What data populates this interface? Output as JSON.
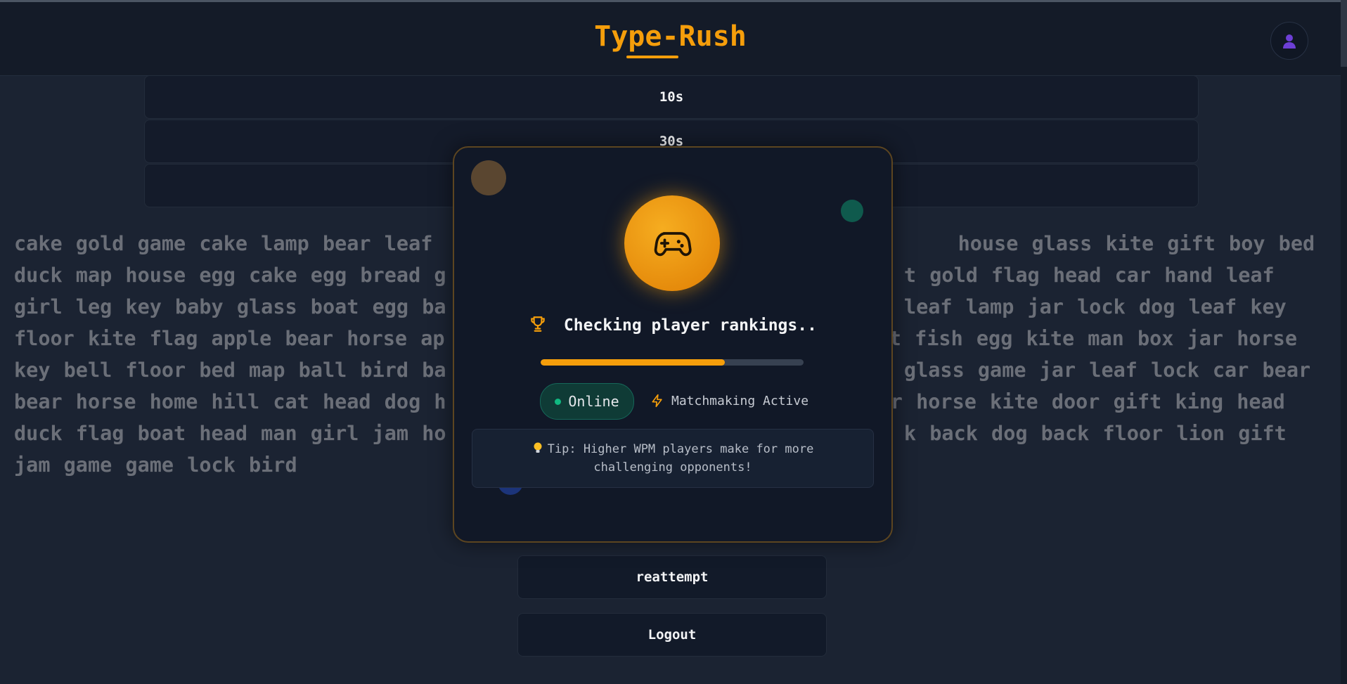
{
  "app": {
    "title": "Type-Rush"
  },
  "header": {
    "avatar_icon": "user-icon"
  },
  "modes": [
    {
      "label": "10s"
    },
    {
      "label": "30s"
    },
    {
      "label": ""
    }
  ],
  "words": {
    "text": "cake gold game cake lamp bear leaf                                       house glass kite gift boy bed duck map house egg cake egg bread g                                  t gold flag head car hand leaf girl leg key baby glass boat egg ba                                  leaf lamp jar lock dog leaf key floor kite flag apple bear horse ap                                 t fish egg kite man box jar horse key bell floor bed map ball bird ba                                  glass game jar leaf lock car bear bear horse home hill cat head dog h                                 r horse kite door gift king head duck flag boat head man girl jam ho                                  k back dog back floor lion gift jam game game lock bird"
  },
  "actions": {
    "reattempt_label": "reattempt",
    "logout_label": "Logout"
  },
  "modal": {
    "icon": "gamepad-icon",
    "status_icon": "trophy-icon",
    "status_text": "Checking player rankings..",
    "progress": 0.7,
    "online_label": "Online",
    "matchmaking_icon": "lightning-icon",
    "matchmaking_label": "Matchmaking Active",
    "tip_icon": "lightbulb-icon",
    "tip_text": "Tip: Higher WPM players make for more challenging opponents!"
  },
  "colors": {
    "accent": "#f59e0b",
    "background": "#1b2332",
    "online": "#10b981"
  }
}
